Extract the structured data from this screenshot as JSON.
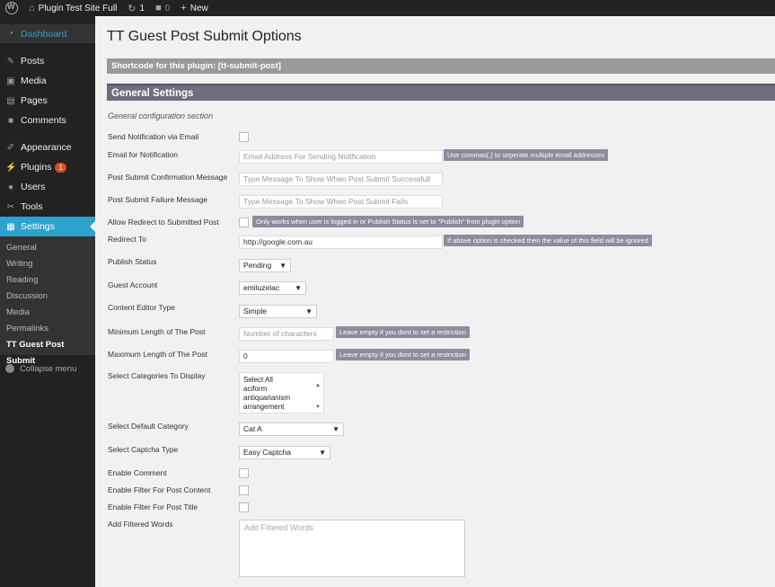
{
  "admin_bar": {
    "site_name": "Plugin Test Site Full",
    "updates_count": "1",
    "comments_count": "0",
    "new_label": "New"
  },
  "sidebar": {
    "items": [
      {
        "label": "Dashboard",
        "icon": "dashboard-icon"
      },
      {
        "label": "Posts",
        "icon": "pin-icon"
      },
      {
        "label": "Media",
        "icon": "media-icon"
      },
      {
        "label": "Pages",
        "icon": "page-icon"
      },
      {
        "label": "Comments",
        "icon": "comment-icon"
      },
      {
        "label": "Appearance",
        "icon": "brush-icon"
      },
      {
        "label": "Plugins",
        "icon": "plug-icon",
        "badge": "1"
      },
      {
        "label": "Users",
        "icon": "user-icon"
      },
      {
        "label": "Tools",
        "icon": "wrench-icon"
      },
      {
        "label": "Settings",
        "icon": "settings-icon"
      }
    ],
    "submenu": [
      "General",
      "Writing",
      "Reading",
      "Discussion",
      "Media",
      "Permalinks",
      "TT Guest Post Submit"
    ],
    "collapse_label": "Collapse menu"
  },
  "page": {
    "title": "TT Guest Post Submit Options",
    "shortcode_text": "Shortcode for this plugin: [tt-submit-post]",
    "section_title": "General Settings",
    "section_desc": "General configuration section"
  },
  "fields": {
    "send_notification": {
      "label": "Send Notification via Email",
      "checked": false
    },
    "email": {
      "label": "Email for Notification",
      "placeholder": "Email Address For Sending Notification",
      "hint": "Use commas(,) to seperate multiple email addresses"
    },
    "confirm_msg": {
      "label": "Post Submit Confirmation Message",
      "placeholder": "Type Message To Show When Post Submit Successfull"
    },
    "failure_msg": {
      "label": "Post Submit Failure Message",
      "placeholder": "Type Message To Show When Post Submit Fails"
    },
    "allow_redirect": {
      "label": "Allow Redirect to Submitted Post",
      "checked": false,
      "hint": "Only works when user is logged in or Publish Status is set to \"Publish\" from plugin option"
    },
    "redirect_to": {
      "label": "Redirect To",
      "value": "http://google.com.au",
      "hint": "If above option is checked then the value of this field will be ignored"
    },
    "publish_status": {
      "label": "Publish Status",
      "value": "Pending"
    },
    "guest_account": {
      "label": "Guest Account",
      "value": "emiluzelac"
    },
    "editor_type": {
      "label": "Content Editor Type",
      "value": "Simple"
    },
    "min_length": {
      "label": "Minimum Length of The Post",
      "placeholder": "Number of characters",
      "hint": "Leave empty if you dont to set a restriction"
    },
    "max_length": {
      "label": "Maximum Length of The Post",
      "value": "0",
      "hint": "Leave empty if you dont to set a restriction"
    },
    "categories": {
      "label": "Select Categories To Display",
      "options": [
        "Select All",
        "aciform",
        "antiquarianism",
        "arrangement"
      ]
    },
    "default_category": {
      "label": "Select Default Category",
      "value": "Cat A"
    },
    "captcha_type": {
      "label": "Select Captcha Type",
      "value": "Easy Captcha"
    },
    "enable_comment": {
      "label": "Enable Comment",
      "checked": false
    },
    "filter_content": {
      "label": "Enable Filter For Post Content",
      "checked": false
    },
    "filter_title": {
      "label": "Enable Filter For Post Title",
      "checked": false
    },
    "filtered_words": {
      "label": "Add Filtered Words",
      "placeholder": "Add Filtered Words"
    }
  }
}
